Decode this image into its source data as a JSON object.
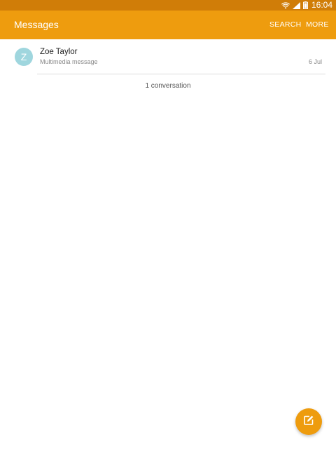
{
  "status_bar": {
    "time": "16:04",
    "icons": [
      "wifi-icon",
      "signal-icon",
      "battery-icon"
    ]
  },
  "app_bar": {
    "title": "Messages",
    "actions": {
      "search": "SEARCH",
      "more": "MORE"
    }
  },
  "conversations": [
    {
      "avatar_letter": "Z",
      "name": "Zoe Taylor",
      "preview": "Multimedia message",
      "date": "6 Jul"
    }
  ],
  "summary": {
    "count_text": "1 conversation"
  },
  "fab": {
    "icon": "compose-icon"
  },
  "colors": {
    "status_bar": "#d07d08",
    "app_bar": "#ee9c0e",
    "avatar": "#9fd6de",
    "fab": "#ee9c0e"
  }
}
